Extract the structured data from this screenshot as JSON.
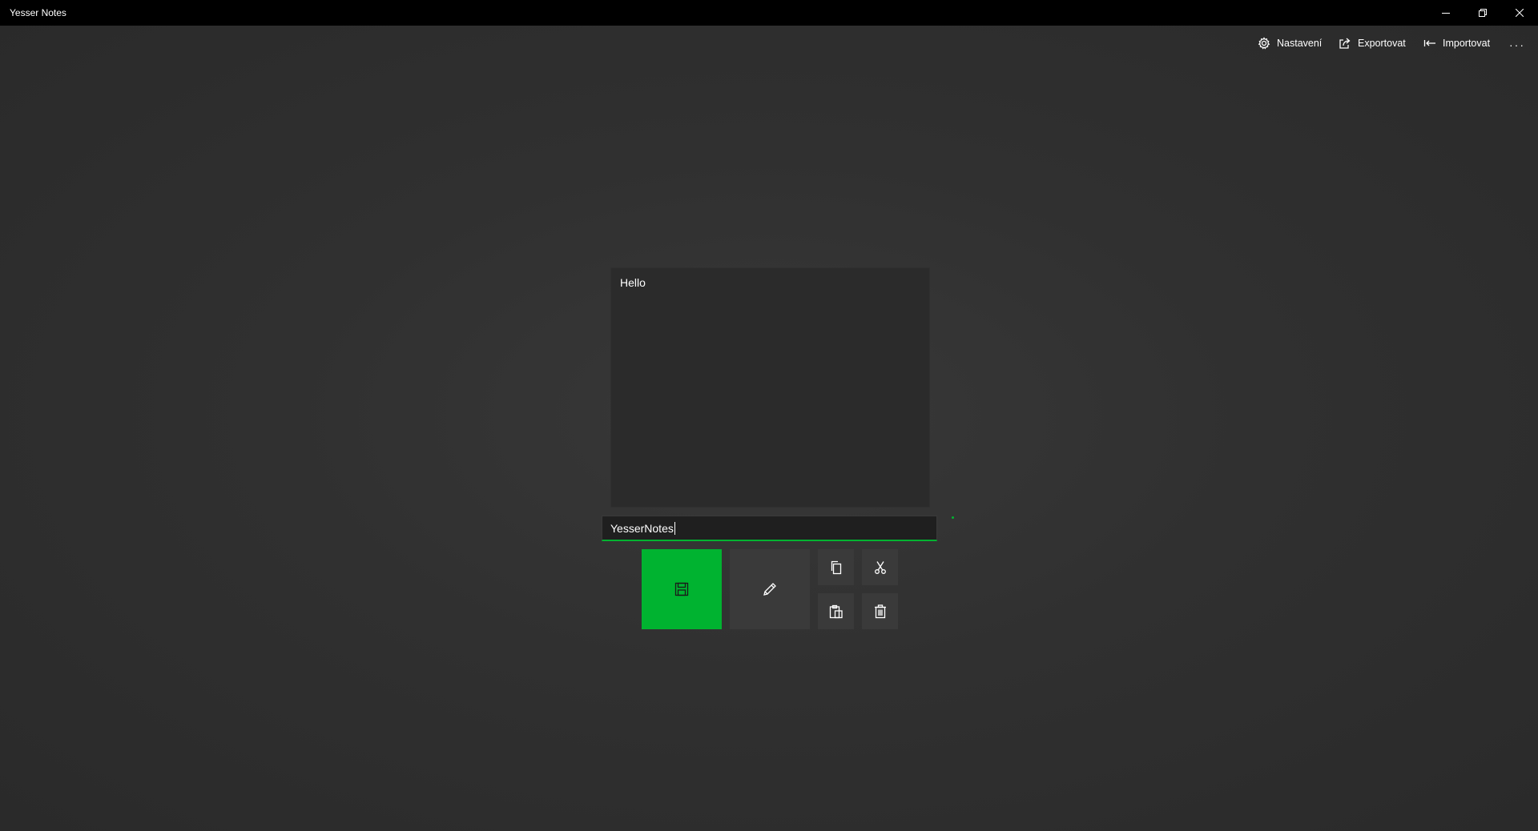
{
  "window": {
    "title": "Yesser Notes",
    "controls": [
      "minimize-icon",
      "restore-icon",
      "close-icon"
    ]
  },
  "commandbar": {
    "settings_label": "Nastavení",
    "export_label": "Exportovat",
    "import_label": "Importovat",
    "more_icon": "more-icon"
  },
  "note": {
    "content": "Hello"
  },
  "name_input": {
    "value": "YesserNotes"
  },
  "actions": {
    "save_icon": "save-icon",
    "edit_icon": "pencil-icon",
    "copy_icon": "copy-icon",
    "cut_icon": "scissors-icon",
    "paste_icon": "paste-icon",
    "delete_icon": "trash-icon"
  },
  "colors": {
    "accent": "#00b330",
    "titlebar": "#000000",
    "background": "#333333",
    "button": "#3a3a3a",
    "note_bg": "#2b2b2b"
  }
}
